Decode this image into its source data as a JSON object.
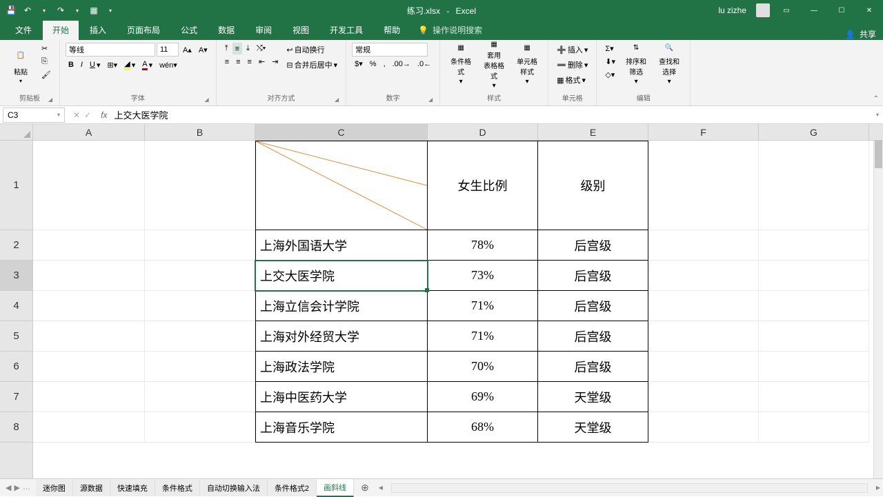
{
  "title": {
    "filename": "练习.xlsx",
    "sep": "-",
    "app": "Excel"
  },
  "account": {
    "name": "lu zizhe"
  },
  "qat": {
    "undo": "↶",
    "redo": "↷",
    "save": "💾"
  },
  "tabs": {
    "file": "文件",
    "home": "开始",
    "insert": "插入",
    "page_layout": "页面布局",
    "formulas": "公式",
    "data": "数据",
    "review": "审阅",
    "view": "视图",
    "developer": "开发工具",
    "help": "帮助",
    "tell_me": "操作说明搜索"
  },
  "share": "共享",
  "ribbon": {
    "clipboard": {
      "label": "剪贴板",
      "paste": "粘贴"
    },
    "font": {
      "label": "字体",
      "name": "等线",
      "size": "11"
    },
    "alignment": {
      "label": "对齐方式",
      "wrap": "自动换行",
      "merge": "合并后居中"
    },
    "number": {
      "label": "数字",
      "format": "常规"
    },
    "styles": {
      "label": "样式",
      "cond": "条件格式",
      "table": "套用\n表格格式",
      "cell": "单元格样式"
    },
    "cells": {
      "label": "单元格",
      "insert": "插入",
      "delete": "删除",
      "format": "格式"
    },
    "editing": {
      "label": "编辑",
      "sort": "排序和筛选",
      "find": "查找和选择"
    }
  },
  "namebox": "C3",
  "formula": "上交大医学院",
  "columns": [
    "A",
    "B",
    "C",
    "D",
    "E",
    "F",
    "G"
  ],
  "rows": [
    "1",
    "2",
    "3",
    "4",
    "5",
    "6",
    "7",
    "8"
  ],
  "headers": {
    "D1": "女生比例",
    "E1": "级别"
  },
  "table": [
    {
      "c": "上海外国语大学",
      "d": "78%",
      "e": "后宫级"
    },
    {
      "c": "上交大医学院",
      "d": "73%",
      "e": "后宫级"
    },
    {
      "c": "上海立信会计学院",
      "d": "71%",
      "e": "后宫级"
    },
    {
      "c": "上海对外经贸大学",
      "d": "71%",
      "e": "后宫级"
    },
    {
      "c": "上海政法学院",
      "d": "70%",
      "e": "后宫级"
    },
    {
      "c": "上海中医药大学",
      "d": "69%",
      "e": "天堂级"
    },
    {
      "c": "上海音乐学院",
      "d": "68%",
      "e": "天堂级"
    }
  ],
  "sheet_tabs": {
    "sparkline": "迷你图",
    "source": "源数据",
    "flash": "快速填充",
    "cond1": "条件格式",
    "ime": "自动切换输入法",
    "cond2": "条件格式2",
    "diag": "画斜线"
  }
}
